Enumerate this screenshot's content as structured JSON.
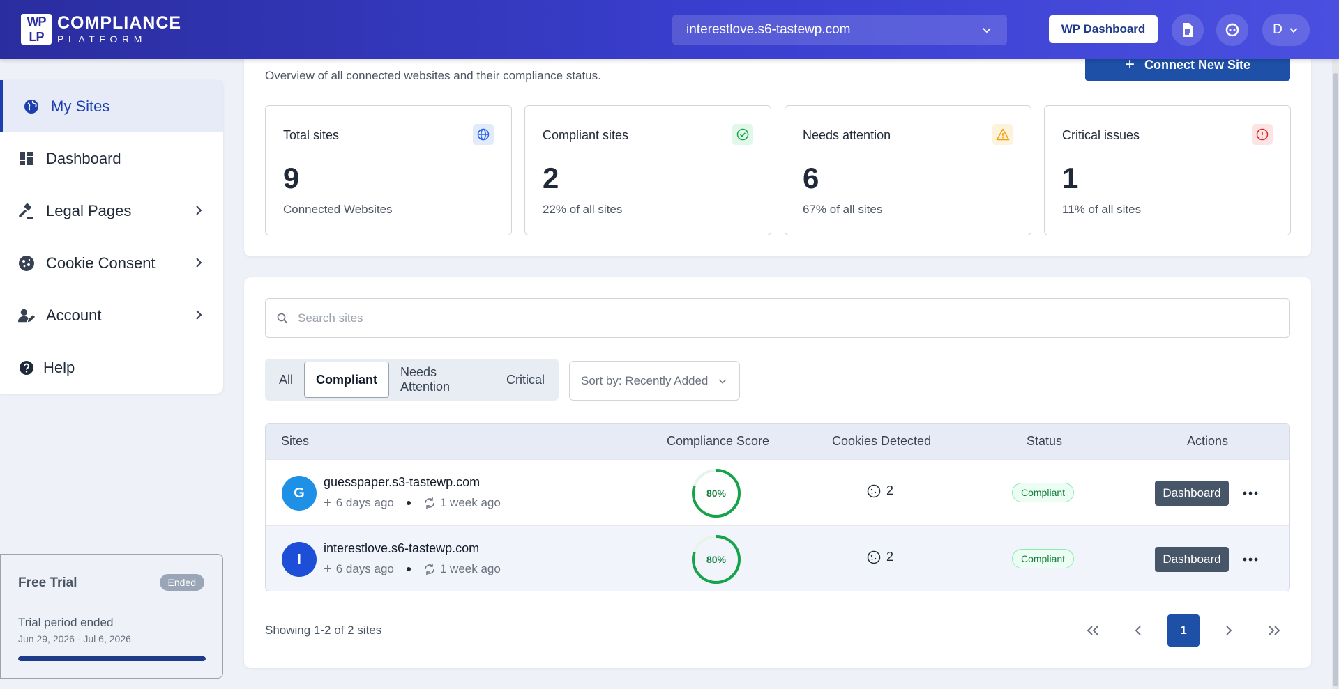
{
  "header": {
    "logo_mark": [
      "WP",
      "LP"
    ],
    "logo_line1": "COMPLIANCE",
    "logo_line2": "PLATFORM",
    "site_selector": "interestlove.s6-tastewp.com",
    "wp_dashboard_label": "WP Dashboard",
    "user_initial": "D"
  },
  "sidebar": {
    "items": [
      {
        "label": "My Sites",
        "icon": "globe-icon",
        "active": true
      },
      {
        "label": "Dashboard",
        "icon": "dashboard-icon"
      },
      {
        "label": "Legal Pages",
        "icon": "gavel-icon",
        "has_submenu": true
      },
      {
        "label": "Cookie Consent",
        "icon": "cookie-icon",
        "has_submenu": true
      },
      {
        "label": "Account",
        "icon": "user-edit-icon",
        "has_submenu": true
      },
      {
        "label": "Help",
        "icon": "help-icon"
      }
    ],
    "trial": {
      "title": "Free Trial",
      "badge": "Ended",
      "status": "Trial period ended",
      "dates": "Jun 29, 2026 - Jul 6, 2026",
      "progress": 1.0
    }
  },
  "main": {
    "subtitle": "Overview of all connected websites and their compliance status.",
    "connect_label": "Connect New Site",
    "stats": [
      {
        "label": "Total sites",
        "value": "9",
        "note": "Connected Websites",
        "icon": "globe-icon",
        "color": "#2563eb"
      },
      {
        "label": "Compliant sites",
        "value": "2",
        "note": "22% of all sites",
        "icon": "check-circle-icon",
        "color": "#16a34a"
      },
      {
        "label": "Needs attention",
        "value": "6",
        "note": "67% of all sites",
        "icon": "warning-icon",
        "color": "#f59e0b"
      },
      {
        "label": "Critical issues",
        "value": "1",
        "note": "11% of all sites",
        "icon": "alert-circle-icon",
        "color": "#dc2626"
      }
    ],
    "search_placeholder": "Search sites",
    "filters": [
      "All",
      "Compliant",
      "Needs Attention",
      "Critical"
    ],
    "active_filter": "Compliant",
    "sort_label": "Sort by: Recently Added",
    "table": {
      "headers": [
        "Sites",
        "Compliance Score",
        "Cookies Detected",
        "Status",
        "Actions"
      ],
      "rows": [
        {
          "initial": "G",
          "avatar_color": "#1e90e6",
          "name": "guesspaper.s3-tastewp.com",
          "added": "6 days ago",
          "synced": "1 week ago",
          "score": 80,
          "score_label": "80%",
          "cookies": "2",
          "status": "Compliant",
          "action": "Dashboard"
        },
        {
          "initial": "I",
          "avatar_color": "#1d4ed8",
          "name": "interestlove.s6-tastewp.com",
          "added": "6 days ago",
          "synced": "1 week ago",
          "score": 80,
          "score_label": "80%",
          "cookies": "2",
          "status": "Compliant",
          "action": "Dashboard"
        }
      ]
    },
    "showing": "Showing 1-2 of 2 sites",
    "current_page": "1"
  }
}
